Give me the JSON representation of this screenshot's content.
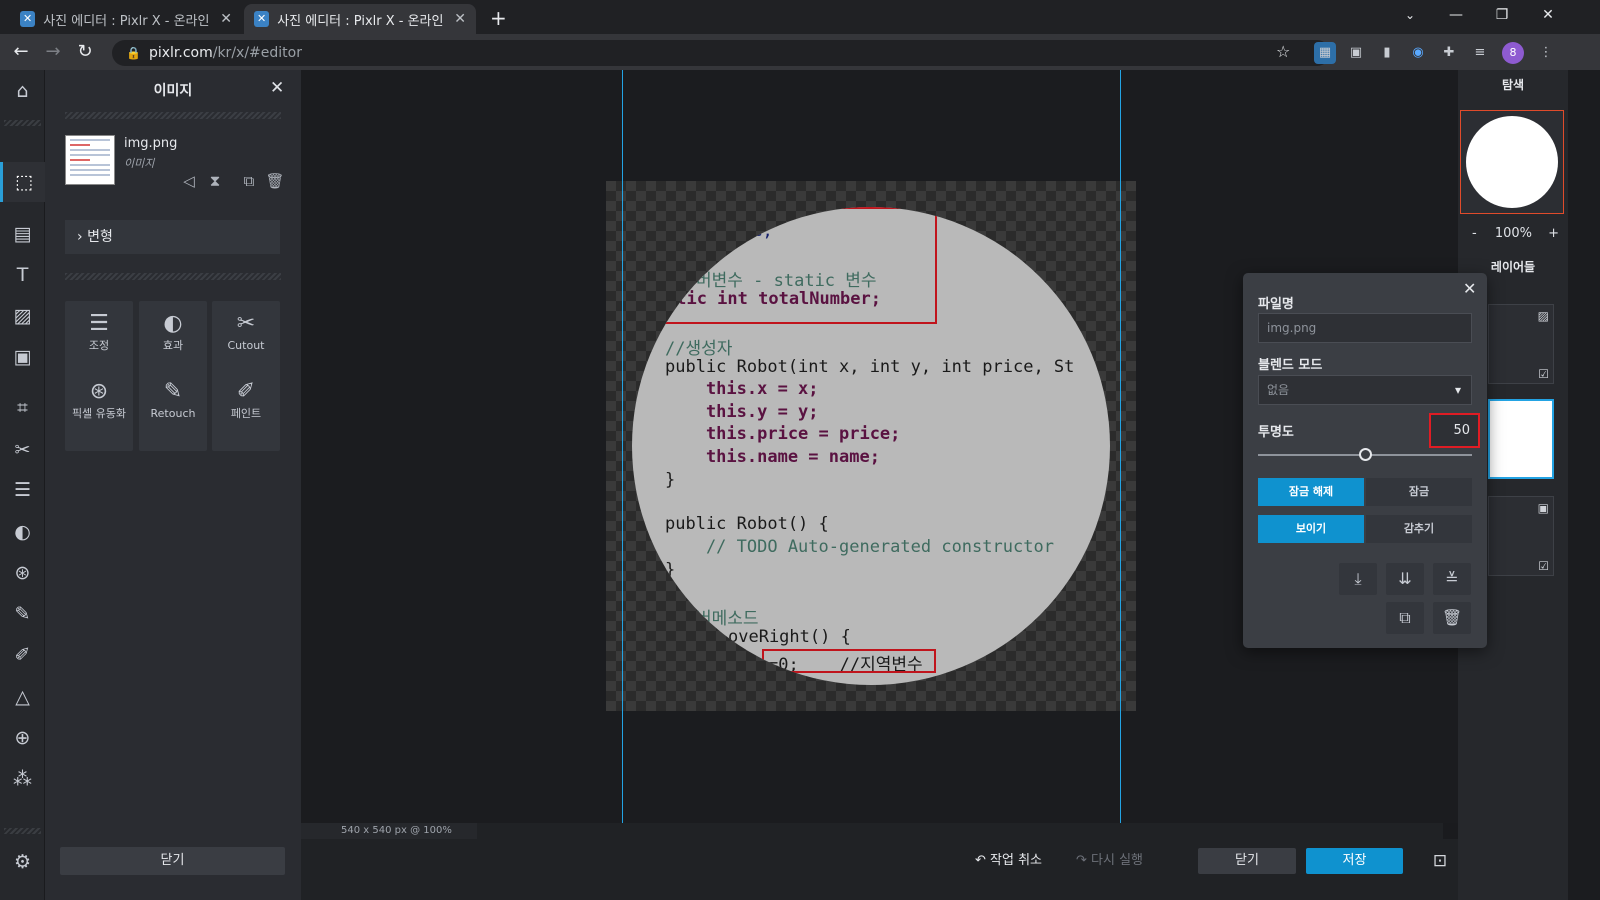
{
  "browser": {
    "tabs": [
      {
        "title": "사진 에디터 : Pixlr X - 온라인 무"
      },
      {
        "title": "사진 에디터 : Pixlr X - 온라인 무"
      }
    ],
    "url_host": "pixlr.com",
    "url_path": "/kr/x/#editor",
    "profile_initial": "8"
  },
  "left_panel": {
    "title": "이미지",
    "layer_name": "img.png",
    "layer_type": "이미지",
    "transform_label": "변형",
    "tools": [
      {
        "label": "조정",
        "icon": "sliders-icon"
      },
      {
        "label": "효과",
        "icon": "contrast-icon"
      },
      {
        "label": "Cutout",
        "icon": "scissors-icon"
      },
      {
        "label": "픽셀 유동화",
        "icon": "swirl-icon"
      },
      {
        "label": "Retouch",
        "icon": "bandage-icon"
      },
      {
        "label": "페인트",
        "icon": "brush-icon"
      }
    ],
    "close_label": "닫기"
  },
  "canvas": {
    "status": "540 x 540 px @ 100%",
    "code_lines": [
      {
        "text": "me;"
      },
      {
        "text": "버변수 - static 변수"
      },
      {
        "text": "atic int totalNumber;"
      },
      {
        "text": "//생성자"
      },
      {
        "text": "public Robot(int x, int y, int price, St"
      },
      {
        "text": "    this.x = x;"
      },
      {
        "text": "    this.y = y;"
      },
      {
        "text": "    this.price = price;"
      },
      {
        "text": "    this.name = name;"
      },
      {
        "text": "}"
      },
      {
        "text": "public Robot() {"
      },
      {
        "text": "    // TODO Auto-generated constructor"
      },
      {
        "text": "}"
      },
      {
        "text": "버메소드"
      },
      {
        "text": "oveRight() {"
      },
      {
        "text": "=0;    //지역변수"
      }
    ]
  },
  "bottom": {
    "undo_label": "작업 취소",
    "redo_label": "다시 실행",
    "close_label": "닫기",
    "save_label": "저장"
  },
  "right_panel": {
    "navigator_title": "탐색",
    "zoom_minus": "-",
    "zoom_value": "100%",
    "zoom_plus": "+",
    "layers_title": "레이어들"
  },
  "layer_popup": {
    "filename_label": "파일명",
    "filename_value": "img.png",
    "blend_label": "블렌드 모드",
    "blend_value": "없음",
    "opacity_label": "투명도",
    "opacity_value": "50",
    "opacity_fraction": 0.5,
    "unlock_label": "잠금 해제",
    "lock_label": "잠금",
    "show_label": "보이기",
    "hide_label": "감추기"
  },
  "colors": {
    "accent": "#0f92cf",
    "highlight_box": "#e01c24",
    "guide": "#23a3e3"
  }
}
